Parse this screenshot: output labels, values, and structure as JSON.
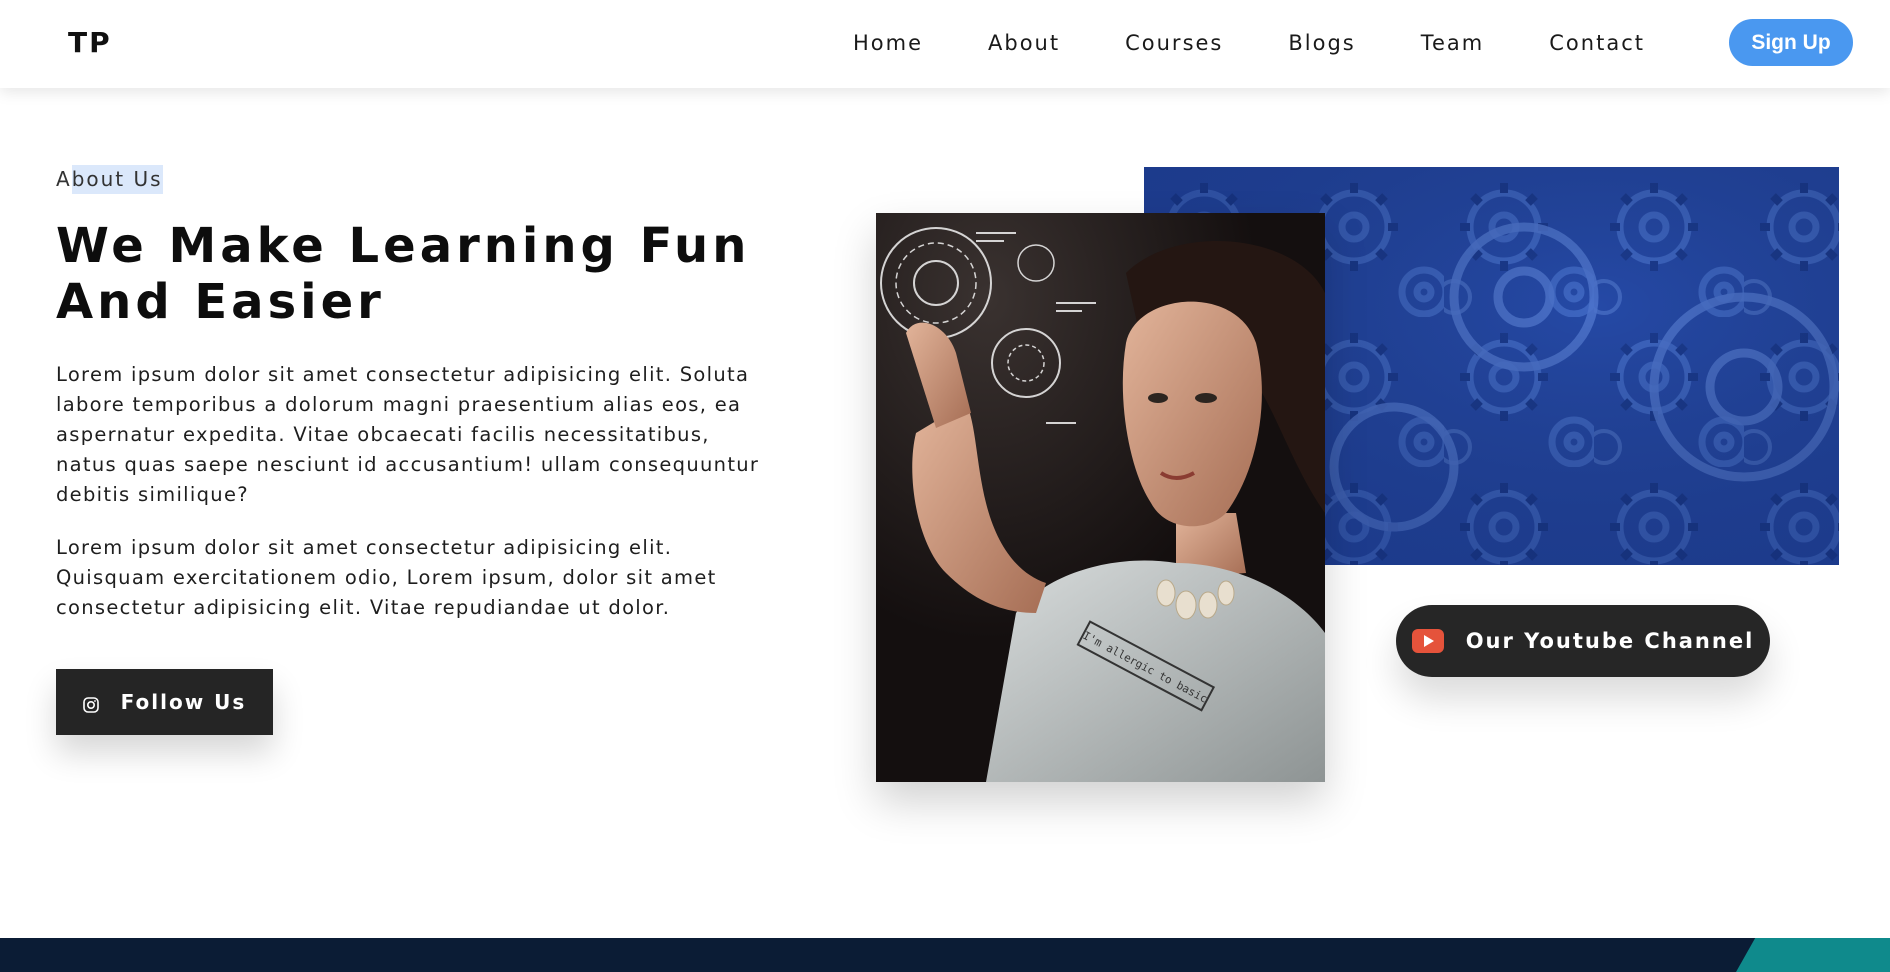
{
  "header": {
    "logo": "TP",
    "nav": [
      "Home",
      "About",
      "Courses",
      "Blogs",
      "Team",
      "Contact"
    ],
    "signup_label": "Sign Up"
  },
  "about": {
    "eyebrow_first": "A",
    "eyebrow_rest": "bout Us",
    "heading_line1": "We Make Learning Fun",
    "heading_line2": "And Easier",
    "para1": "Lorem ipsum dolor sit amet consectetur adipisicing elit. Soluta labore temporibus a dolorum magni praesentium alias eos, ea aspernatur expedita. Vitae obcaecati facilis necessitatibus, natus quas saepe nesciunt id accusantium! ullam consequuntur debitis similique?",
    "para2": "Lorem ipsum dolor sit amet consectetur adipisicing elit. Quisquam exercitationem odio, Lorem ipsum, dolor sit amet consectetur adipisicing elit. Vitae repudiandae ut dolor.",
    "follow_label": "Follow Us",
    "shirt_text": "I'm allergic to basic",
    "youtube_label": "Our Youtube Channel"
  },
  "colors": {
    "accent_blue": "#4a98f0",
    "dark_button": "#252525",
    "gears_blue": "#2549a6",
    "footer_navy": "#0b1c35",
    "footer_teal": "#0f8a8c",
    "youtube_red": "#e5533b"
  },
  "icons": {
    "follow": "instagram-icon",
    "youtube": "youtube-icon"
  }
}
